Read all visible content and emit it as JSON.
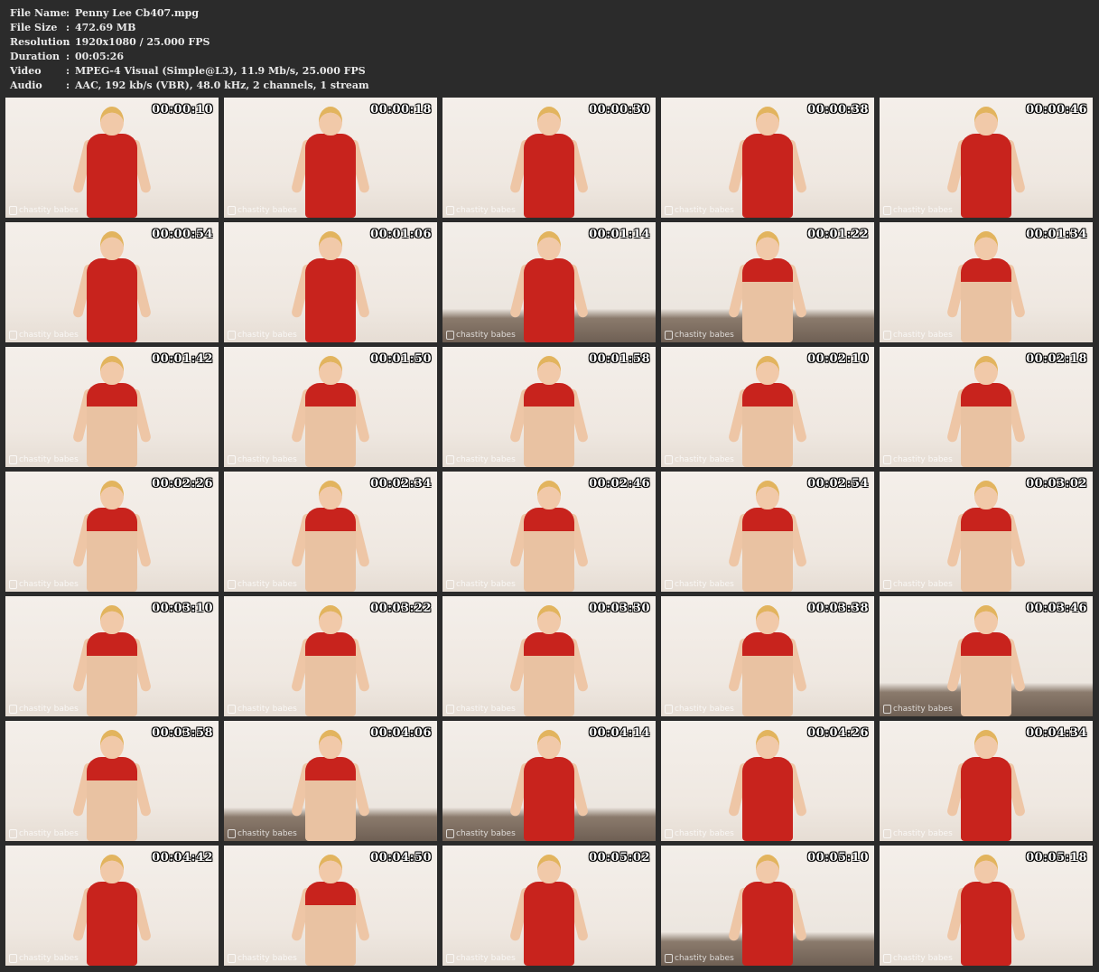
{
  "info": [
    {
      "label": "File Name",
      "sep": ":",
      "value": "Penny Lee Cb407.mpg"
    },
    {
      "label": "File Size",
      "sep": ":",
      "value": "472.69 MB"
    },
    {
      "label": "Resolution",
      "sep": ":",
      "value": "1920x1080 / 25.000 FPS"
    },
    {
      "label": "Duration",
      "sep": ":",
      "value": "00:05:26"
    },
    {
      "label": "Video",
      "sep": ":",
      "value": "MPEG-4 Visual (Simple@L3), 11.9 Mb/s, 25.000 FPS"
    },
    {
      "label": "Audio",
      "sep": ":",
      "value": "AAC, 192 kb/s (VBR), 48.0 kHz, 2 channels, 1 stream"
    }
  ],
  "watermark": "chastity babes",
  "thumbnails": [
    {
      "time": "00:00:10",
      "outfit": "dress",
      "floor": false
    },
    {
      "time": "00:00:18",
      "outfit": "dress",
      "floor": false
    },
    {
      "time": "00:00:30",
      "outfit": "dress",
      "floor": false
    },
    {
      "time": "00:00:38",
      "outfit": "dress",
      "floor": false
    },
    {
      "time": "00:00:46",
      "outfit": "dress",
      "floor": false
    },
    {
      "time": "00:00:54",
      "outfit": "dress",
      "floor": false
    },
    {
      "time": "00:01:06",
      "outfit": "dress",
      "floor": false
    },
    {
      "time": "00:01:14",
      "outfit": "dress",
      "floor": true
    },
    {
      "time": "00:01:22",
      "outfit": "skin",
      "floor": true
    },
    {
      "time": "00:01:34",
      "outfit": "skin",
      "floor": false
    },
    {
      "time": "00:01:42",
      "outfit": "skin",
      "floor": false
    },
    {
      "time": "00:01:50",
      "outfit": "skin",
      "floor": false
    },
    {
      "time": "00:01:58",
      "outfit": "skin",
      "floor": false
    },
    {
      "time": "00:02:10",
      "outfit": "skin",
      "floor": false
    },
    {
      "time": "00:02:18",
      "outfit": "skin",
      "floor": false
    },
    {
      "time": "00:02:26",
      "outfit": "skin",
      "floor": false
    },
    {
      "time": "00:02:34",
      "outfit": "skin",
      "floor": false
    },
    {
      "time": "00:02:46",
      "outfit": "skin",
      "floor": false
    },
    {
      "time": "00:02:54",
      "outfit": "skin",
      "floor": false
    },
    {
      "time": "00:03:02",
      "outfit": "skin",
      "floor": false
    },
    {
      "time": "00:03:10",
      "outfit": "skin",
      "floor": false
    },
    {
      "time": "00:03:22",
      "outfit": "skin",
      "floor": false
    },
    {
      "time": "00:03:30",
      "outfit": "skin",
      "floor": false
    },
    {
      "time": "00:03:38",
      "outfit": "skin",
      "floor": false
    },
    {
      "time": "00:03:46",
      "outfit": "skin",
      "floor": true
    },
    {
      "time": "00:03:58",
      "outfit": "skin",
      "floor": false
    },
    {
      "time": "00:04:06",
      "outfit": "skin",
      "floor": true
    },
    {
      "time": "00:04:14",
      "outfit": "dress",
      "floor": true
    },
    {
      "time": "00:04:26",
      "outfit": "dress",
      "floor": false
    },
    {
      "time": "00:04:34",
      "outfit": "dress",
      "floor": false
    },
    {
      "time": "00:04:42",
      "outfit": "dress",
      "floor": false
    },
    {
      "time": "00:04:50",
      "outfit": "skin",
      "floor": false
    },
    {
      "time": "00:05:02",
      "outfit": "dress",
      "floor": false
    },
    {
      "time": "00:05:10",
      "outfit": "dress",
      "floor": true
    },
    {
      "time": "00:05:18",
      "outfit": "dress",
      "floor": false
    }
  ],
  "colors": {
    "background": "#2b2b2b",
    "text": "#e8e8e8",
    "dress": "#c8231d",
    "wall": "#f4efea"
  }
}
